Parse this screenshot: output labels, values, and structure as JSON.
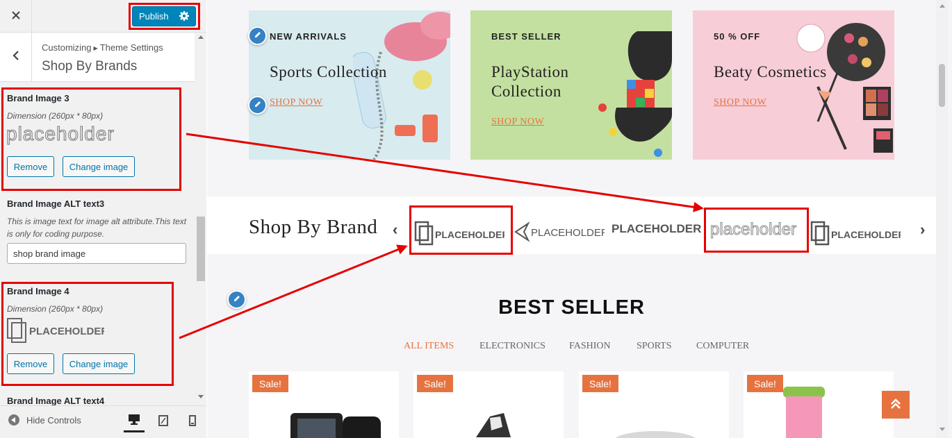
{
  "customizer": {
    "close_icon": "close-icon",
    "publish_label": "Publish",
    "breadcrumb_root": "Customizing",
    "breadcrumb_parent": "Theme Settings",
    "section_title": "Shop By Brands",
    "controls": {
      "brand_image_3": {
        "label": "Brand Image 3",
        "dimension": "Dimension (260px * 80px)",
        "logo_text": "placeholder",
        "remove_label": "Remove",
        "change_label": "Change image"
      },
      "alt_text_3": {
        "label": "Brand Image ALT text3",
        "description": "This is image text for image alt attribute.This text is only for coding purpose.",
        "value": "shop brand image"
      },
      "brand_image_4": {
        "label": "Brand Image 4",
        "dimension": "Dimension (260px * 80px)",
        "logo_text": "PLACEHOLDER",
        "remove_label": "Remove",
        "change_label": "Change image"
      },
      "alt_text_4": {
        "label": "Brand Image ALT text4"
      }
    },
    "footer": {
      "hide_controls_label": "Hide Controls",
      "devices": [
        "desktop",
        "tablet",
        "mobile"
      ],
      "active_device": "desktop"
    }
  },
  "preview": {
    "banners": [
      {
        "tag": "NEW ARRIVALS",
        "title": "Sports Collection",
        "cta": "SHOP NOW",
        "bg": "#d8ebef"
      },
      {
        "tag": "BEST SELLER",
        "title": "PlayStation Collection",
        "cta": "SHOP NOW",
        "bg": "#c3e0a0"
      },
      {
        "tag": "50 % OFF",
        "title": "Beaty Cosmetics",
        "cta": "SHOP NOW",
        "bg": "#f7cdd8"
      }
    ],
    "brands": {
      "title": "Shop By Brand",
      "logos": [
        "PLACEHOLDER",
        "PLACEHOLDER",
        "PLACEHOLDER",
        "placeholder",
        "PLACEHOLDER"
      ]
    },
    "best_seller": {
      "title": "BEST SELLER",
      "filters": [
        "ALL ITEMS",
        "ELECTRONICS",
        "FASHION",
        "SPORTS",
        "COMPUTER"
      ],
      "active_filter": "ALL ITEMS",
      "sale_badge": "Sale!"
    }
  },
  "colors": {
    "publish": "#0085ba",
    "highlight": "#e60000",
    "accent": "#e6733f",
    "edit_pencil": "#3582c4"
  }
}
